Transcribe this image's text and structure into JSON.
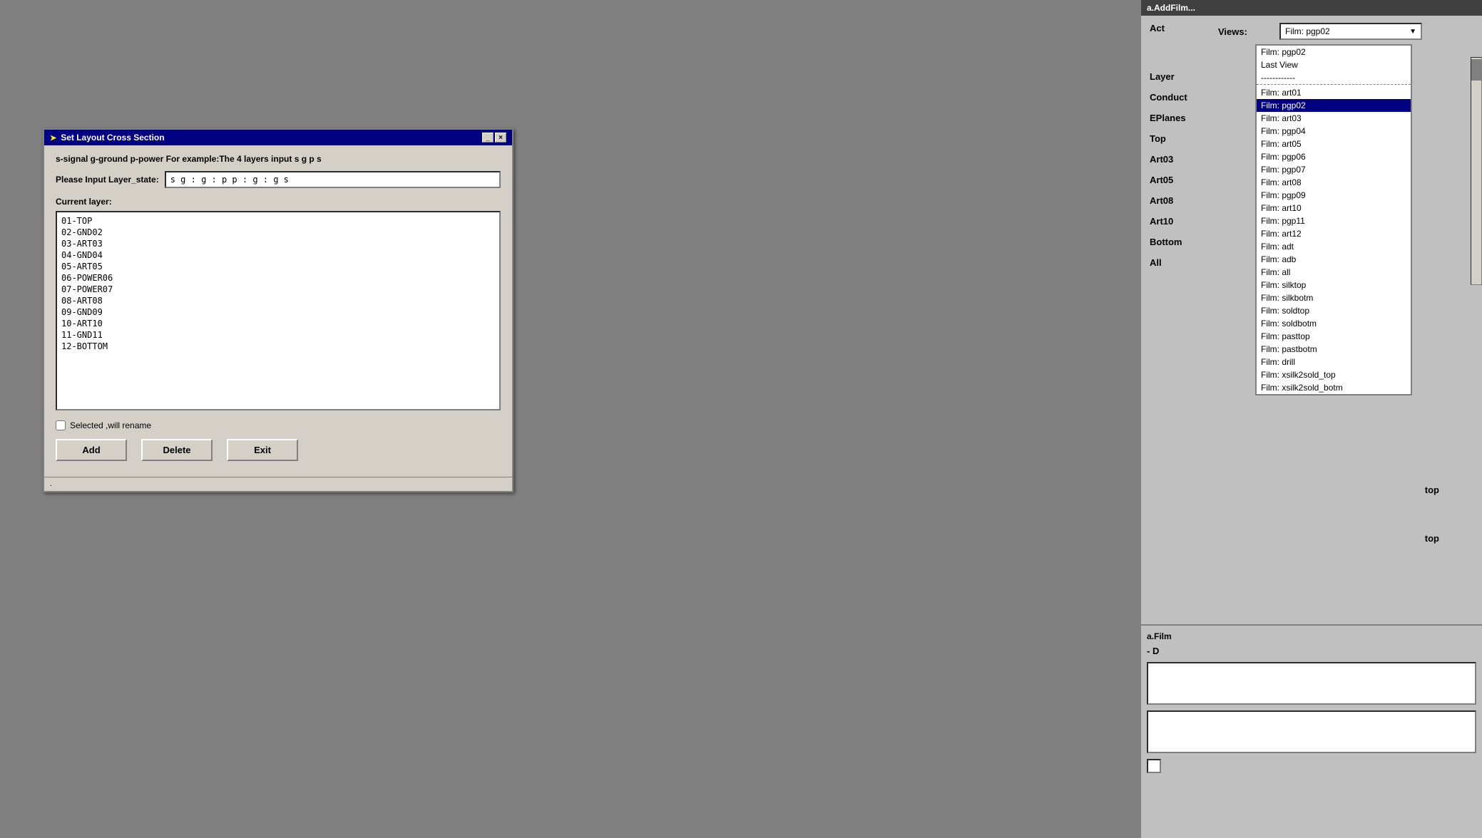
{
  "dialog": {
    "title": "Set Layout Cross Section",
    "minimize_label": "_",
    "close_label": "×",
    "hint_text": "s-signal g-ground p-power  For example:The 4 layers input s g p s",
    "input_label": "Please Input Layer_state:",
    "input_value": "s g : g : p p : g : g s",
    "current_layer_label": "Current layer:",
    "layers": [
      "01-TOP",
      "02-GND02",
      "03-ART03",
      "04-GND04",
      "05-ART05",
      "06-POWER06",
      "07-POWER07",
      "08-ART08",
      "09-GND09",
      "10-ART10",
      "11-GND11",
      "12-BOTTOM"
    ],
    "checkbox_label": "Selected ,will rename",
    "add_button": "Add",
    "delete_button": "Delete",
    "exit_button": "Exit",
    "statusbar_text": "."
  },
  "right_panel": {
    "header_text": "a.AddFilm...",
    "act_label": "Act",
    "views_label": "Views:",
    "views_selected": "Film: pgp02",
    "layer_label": "Layer",
    "conduct_label": "Conduct",
    "eplanes_label": "EPlanes",
    "top_label": "Top",
    "art03_label": "Art03",
    "art05_label": "Art05",
    "art08_label": "Art08",
    "art10_label": "Art10",
    "bottom_label": "Bottom",
    "all_label": "All",
    "dropdown_items": [
      {
        "label": "Film: pgp02",
        "selected": true
      },
      {
        "label": "Last View",
        "selected": false
      },
      {
        "label": "------------",
        "separator": true
      },
      {
        "label": "Film: art01",
        "selected": false
      },
      {
        "label": "Film: pgp02",
        "highlighted": true
      },
      {
        "label": "Film: art03",
        "selected": false
      },
      {
        "label": "Film: pgp04",
        "selected": false
      },
      {
        "label": "Film: art05",
        "selected": false
      },
      {
        "label": "Film: pgp06",
        "selected": false
      },
      {
        "label": "Film: pgp07",
        "selected": false
      },
      {
        "label": "Film: art08",
        "selected": false
      },
      {
        "label": "Film: pgp09",
        "selected": false
      },
      {
        "label": "Film: art10",
        "selected": false
      },
      {
        "label": "Film: pgp11",
        "selected": false
      },
      {
        "label": "Film: art12",
        "selected": false
      },
      {
        "label": "Film: adt",
        "selected": false
      },
      {
        "label": "Film: adb",
        "selected": false
      },
      {
        "label": "Film: all",
        "selected": false
      },
      {
        "label": "Film: silktop",
        "selected": false
      },
      {
        "label": "Film: silkbotm",
        "selected": false
      },
      {
        "label": "Film: soldtop",
        "selected": false
      },
      {
        "label": "Film: soldbotm",
        "selected": false
      },
      {
        "label": "Film: pasttop",
        "selected": false
      },
      {
        "label": "Film: pastbotm",
        "selected": false
      },
      {
        "label": "Film: drill",
        "selected": false
      },
      {
        "label": "Film: xsilk2sold_top",
        "selected": false
      },
      {
        "label": "Film: xsilk2sold_botm",
        "selected": false
      }
    ],
    "top_text1": "top",
    "top_text2": "top",
    "bottom_section_header": "a.Film",
    "d_label": "- D"
  }
}
